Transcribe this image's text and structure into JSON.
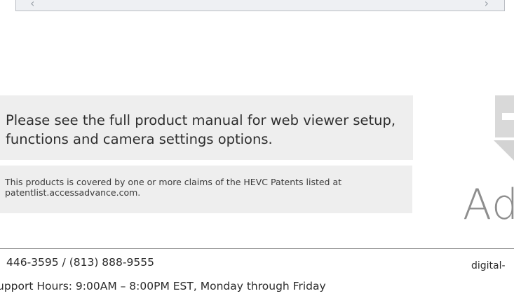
{
  "scrollbar": {
    "left_arrow": "‹",
    "right_arrow": "›"
  },
  "manual_note": "Please see the full product manual for web viewer setup, functions and camera settings options.",
  "patent_note": "This products is covered by one or more claims of the HEVC Patents listed at patentlist.accessadvance.com.",
  "logo": {
    "text": "Ad"
  },
  "footer": {
    "phone": "446-3595 / (813) 888-9555",
    "website": "digital-",
    "hours": "upport Hours: 9:00AM – 8:00PM EST, Monday through Friday"
  },
  "colors": {
    "panel_bg": "#eeeeee",
    "logo_gray": "#8e8e8e",
    "divider": "#8c8c8c"
  }
}
